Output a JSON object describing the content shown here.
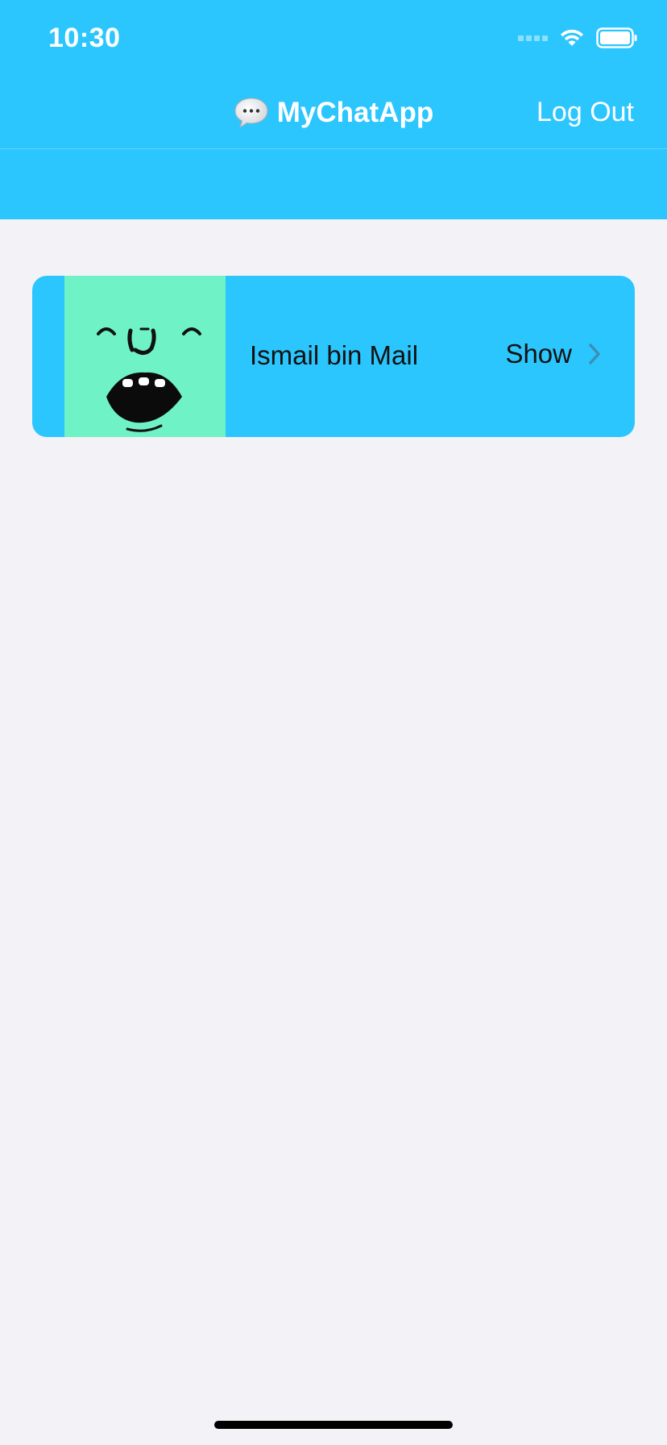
{
  "status_bar": {
    "time": "10:30",
    "signal_icon": "cellular-signal-icon",
    "wifi_icon": "wifi-icon",
    "battery_icon": "battery-icon"
  },
  "nav_bar": {
    "title_icon": "speech-bubble-icon",
    "title": "MyChatApp",
    "logout_label": "Log Out"
  },
  "contacts": [
    {
      "name": "Ismail bin Mail",
      "action_label": "Show",
      "avatar_icon": "cartoon-face-avatar",
      "action_icon": "chevron-right-icon"
    }
  ],
  "colors": {
    "accent": "#2bc6fe",
    "avatar_bg": "#6ff2c6",
    "background": "#f2f2f7"
  }
}
